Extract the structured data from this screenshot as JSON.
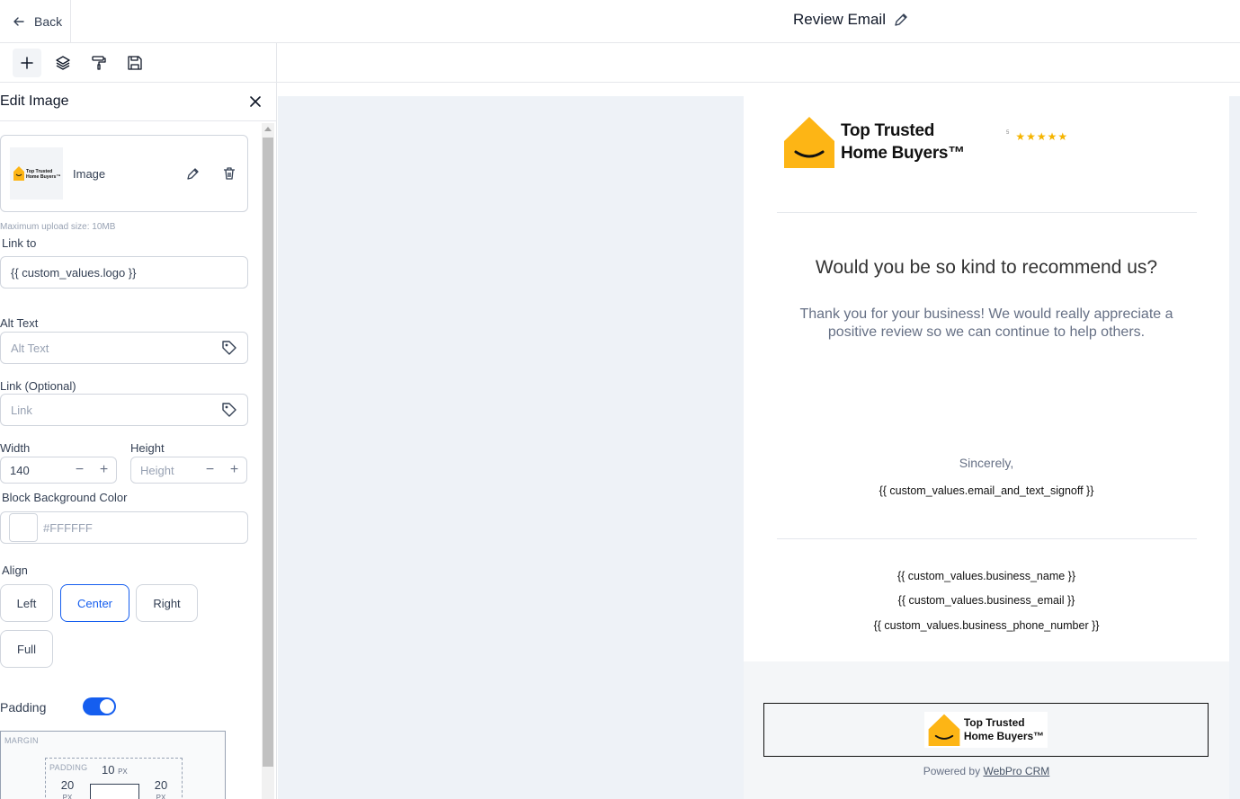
{
  "header": {
    "back_label": "Back",
    "title": "Review Email"
  },
  "toolbar": {
    "icons": [
      "plus-icon",
      "layers-icon",
      "paint-roller-icon",
      "save-icon"
    ]
  },
  "panel": {
    "title": "Edit Image",
    "image_card_label": "Image",
    "upload_hint": "Maximum upload size: 10MB",
    "link_to_label": "Link to",
    "link_to_value": "{{ custom_values.logo }}",
    "alt_text_label": "Alt Text",
    "alt_text_placeholder": "Alt Text",
    "link_optional_label": "Link (Optional)",
    "link_placeholder": "Link",
    "width_label": "Width",
    "width_value": "140",
    "height_label": "Height",
    "height_placeholder": "Height",
    "bg_color_label": "Block Background Color",
    "bg_color_value": "#FFFFFF",
    "align_label": "Align",
    "align_options": [
      "Left",
      "Center",
      "Right",
      "Full"
    ],
    "align_selected": "Center",
    "padding_label": "Padding",
    "padding_enabled": true,
    "margin_caption": "MARGIN",
    "padding_caption": "PADDING",
    "padding_top": "10",
    "padding_left": "20",
    "padding_right": "20",
    "unit": "PX"
  },
  "email": {
    "logo_line1": "Top Trusted",
    "logo_line2": "Home Buyers™",
    "stars_count": "5",
    "stars": "★★★★★",
    "heading": "Would you be so kind to recommend us?",
    "body": "Thank you for your business! We would really appreciate a positive review so we can continue to help others.",
    "sincerely": "Sincerely,",
    "signoff": "{{ custom_values.email_and_text_signoff }}",
    "business_name": "{{ custom_values.business_name }}",
    "business_email": "{{ custom_values.business_email }}",
    "business_phone": "{{ custom_values.business_phone_number }}",
    "powered_prefix": "Powered by",
    "powered_link": "WebPro CRM",
    "accent_color": "#FDB515"
  }
}
